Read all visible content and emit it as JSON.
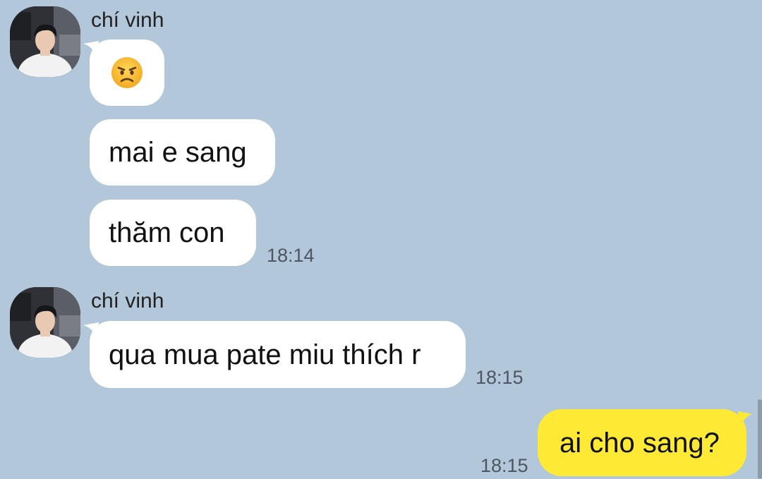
{
  "groups": [
    {
      "sender": "chí vinh",
      "avatar_icon": "profile-photo",
      "messages": [
        {
          "type": "emoji",
          "emoji_icon": "angry-face-icon",
          "text": ""
        },
        {
          "type": "text",
          "text": "mai e sang"
        },
        {
          "type": "text",
          "text": "thăm con",
          "time": "18:14"
        }
      ]
    },
    {
      "sender": "chí vinh",
      "avatar_icon": "profile-photo",
      "messages": [
        {
          "type": "text",
          "text": "qua mua pate miu thích r",
          "time": "18:15"
        }
      ]
    }
  ],
  "outgoing": {
    "text": "ai cho sang?",
    "time": "18:15"
  },
  "colors": {
    "background": "#b2c7da",
    "incoming_bubble": "#ffffff",
    "outgoing_bubble": "#fee934",
    "timestamp": "#4d5661"
  }
}
